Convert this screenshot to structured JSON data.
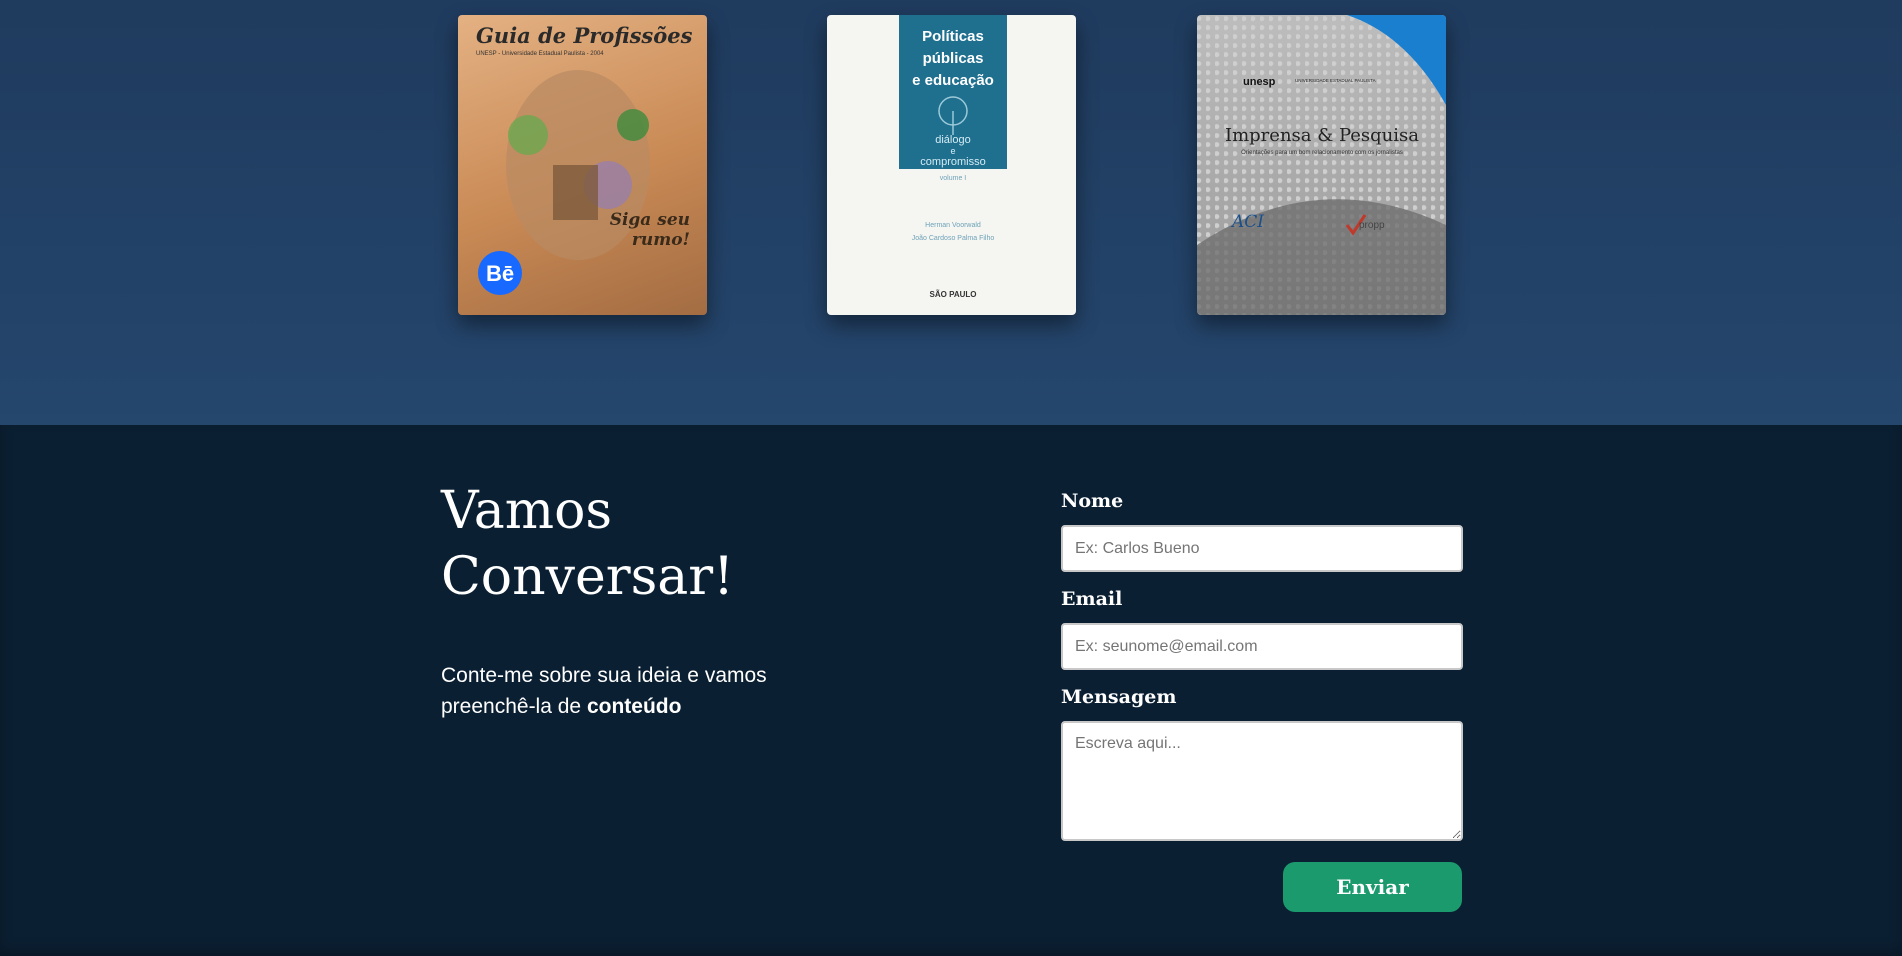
{
  "portfolio": {
    "books": [
      {
        "title": "Guia de Profissões",
        "subtitle": "UNESP - Universidade Estadual Paulista - 2004",
        "tagline_1": "Siga seu",
        "tagline_2": "rumo!",
        "badge": "Bē"
      },
      {
        "title_line_1": "Políticas",
        "title_line_2": "públicas",
        "title_line_3": "e educação",
        "subtitle_1": "diálogo",
        "subtitle_2": "e",
        "subtitle_3": "compromisso",
        "volume": "volume I",
        "author_1": "Herman Voorwald",
        "author_2": "João Cardoso Palma Filho",
        "publisher": "SÃO PAULO"
      },
      {
        "brand": "unesp",
        "brand_full": "UNIVERSIDADE ESTADUAL PAULISTA",
        "title": "Imprensa & Pesquisa",
        "subtitle": "Orientações para um bom relacionamento com os jornalistas",
        "logo_1": "ACI",
        "logo_2": "propp"
      }
    ]
  },
  "contact": {
    "heading_line_1": "Vamos",
    "heading_line_2": "Conversar!",
    "intro_text": "Conte-me sobre sua ideia e vamos preenchê-la de ",
    "intro_emphasis": "conteúdo",
    "form": {
      "name_label": "Nome",
      "name_placeholder": "Ex: Carlos Bueno",
      "email_label": "Email",
      "email_placeholder": "Ex: seunome@email.com",
      "message_label": "Mensagem",
      "message_placeholder": "Escreva aqui...",
      "submit_label": "Enviar"
    }
  },
  "colors": {
    "top_background": "#25466d",
    "bottom_background": "#0b1f32",
    "submit_button": "#1b9a6e",
    "behance_badge": "#1769ff"
  }
}
